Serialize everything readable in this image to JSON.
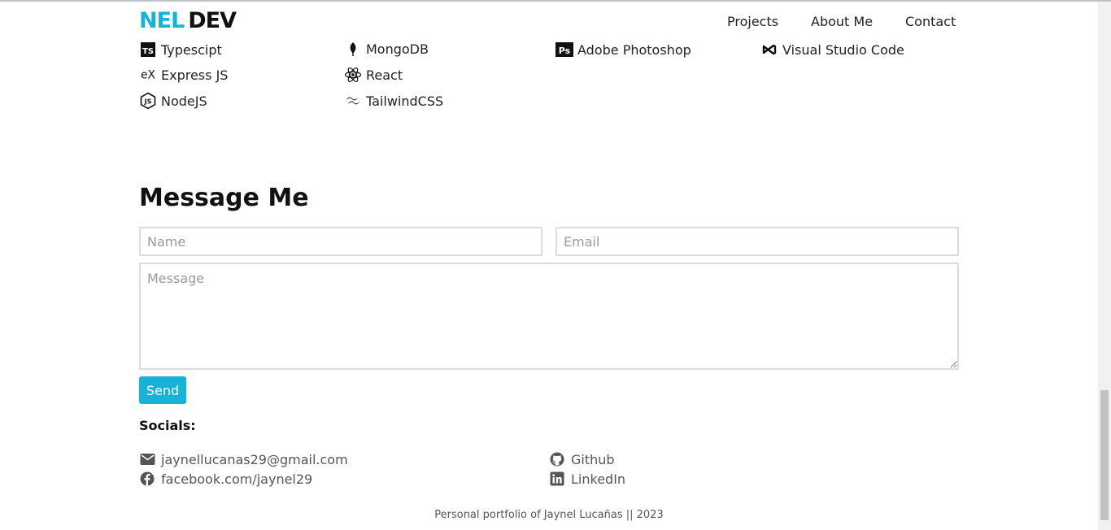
{
  "navbar": {
    "logo_part1": "NEL",
    "logo_part2": "DEV",
    "links": [
      "Projects",
      "About Me",
      "Contact"
    ]
  },
  "skills": [
    {
      "label": "Typescipt",
      "icon": "typescript-icon"
    },
    {
      "label": "MongoDB",
      "icon": "mongodb-icon"
    },
    {
      "label": "Adobe Photoshop",
      "icon": "photoshop-icon"
    },
    {
      "label": "Visual Studio Code",
      "icon": "vscode-icon"
    },
    {
      "label": "Express JS",
      "icon": "express-icon"
    },
    {
      "label": "React",
      "icon": "react-icon"
    },
    {
      "label": "NodeJS",
      "icon": "nodejs-icon"
    },
    {
      "label": "TailwindCSS",
      "icon": "tailwind-icon"
    }
  ],
  "message": {
    "heading": "Message Me",
    "name_placeholder": "Name",
    "email_placeholder": "Email",
    "message_placeholder": "Message",
    "send_label": "Send"
  },
  "socials": {
    "title": "Socials:",
    "email": "jaynellucanas29@gmail.com",
    "facebook": "facebook.com/jaynel29",
    "github": "Github",
    "linkedin": "LinkedIn"
  },
  "footer": {
    "text": "Personal portfolio of Jaynel Lucañas || 2023"
  },
  "colors": {
    "accent": "#16b3d6",
    "text": "#111111",
    "muted": "#555555"
  }
}
